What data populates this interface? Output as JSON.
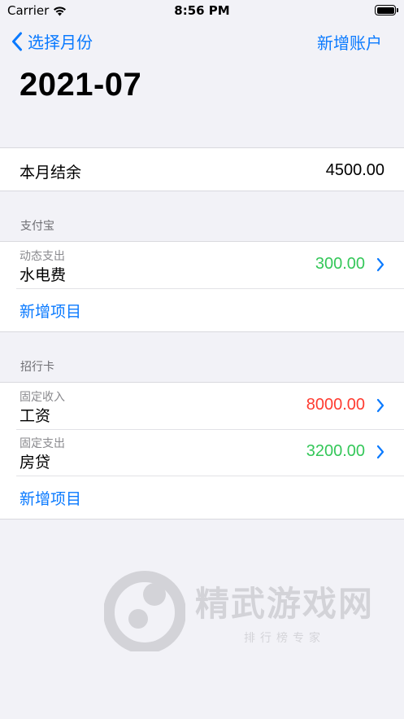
{
  "status_bar": {
    "carrier": "Carrier",
    "time": "8:56 PM"
  },
  "nav": {
    "back_label": "选择月份",
    "right_label": "新增账户",
    "title": "2021-07"
  },
  "balance": {
    "label": "本月结余",
    "value": "4500.00"
  },
  "accounts": [
    {
      "name": "支付宝",
      "items": [
        {
          "type": "动态支出",
          "name": "水电费",
          "amount": "300.00",
          "amount_color": "#34c759"
        }
      ],
      "add_label": "新增项目"
    },
    {
      "name": "招行卡",
      "items": [
        {
          "type": "固定收入",
          "name": "工资",
          "amount": "8000.00",
          "amount_color": "#ff3b30"
        },
        {
          "type": "固定支出",
          "name": "房贷",
          "amount": "3200.00",
          "amount_color": "#34c759"
        }
      ],
      "add_label": "新增项目"
    }
  ],
  "watermark": {
    "title": "精武游戏网",
    "subtitle": "排行榜专家"
  },
  "colors": {
    "accent": "#0a7aff",
    "income": "#ff3b30",
    "expense": "#34c759"
  }
}
